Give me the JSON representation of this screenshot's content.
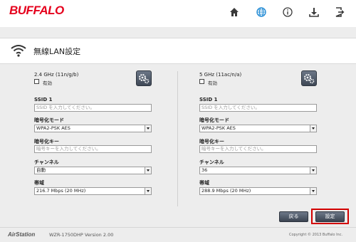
{
  "header": {
    "logo": "BUFFALO",
    "icons": [
      "home-icon",
      "globe-icon",
      "info-icon",
      "download-icon",
      "logout-icon"
    ],
    "active_icon": "globe-icon",
    "brand_color": "#e5001c"
  },
  "page": {
    "title": "無線LAN設定",
    "icon": "wifi-icon"
  },
  "band24": {
    "label": "2.4 GHz (11n/g/b)",
    "enable_label": "有効",
    "enabled": false,
    "ssid_label": "SSID 1",
    "ssid_placeholder": "SSID を入力してください。",
    "encryption_label": "暗号化モード",
    "encryption_value": "WPA2-PSK AES",
    "key_label": "暗号化キー",
    "key_placeholder": "暗号キーを入力してください。",
    "channel_label": "チャンネル",
    "channel_value": "自動",
    "bandwidth_label": "帯域",
    "bandwidth_value": "216.7 Mbps (20 MHz)"
  },
  "band5": {
    "label": "5 GHz (11ac/n/a)",
    "enable_label": "有効",
    "enabled": false,
    "ssid_label": "SSID 1",
    "ssid_placeholder": "SSID を入力してください。",
    "encryption_label": "暗号化モード",
    "encryption_value": "WPA2-PSK AES",
    "key_label": "暗号化キー",
    "key_placeholder": "暗号キーを入力してください。",
    "channel_label": "チャンネル",
    "channel_value": "36",
    "bandwidth_label": "帯域",
    "bandwidth_value": "288.9 Mbps (20 MHz)"
  },
  "actions": {
    "back_label": "戻る",
    "save_label": "設定",
    "highlight_color": "#d20000"
  },
  "footer": {
    "brand": "AirStation",
    "model": "WZR-1750DHP   Version 2.00",
    "copyright": "Copyright © 2013 Buffalo Inc."
  }
}
